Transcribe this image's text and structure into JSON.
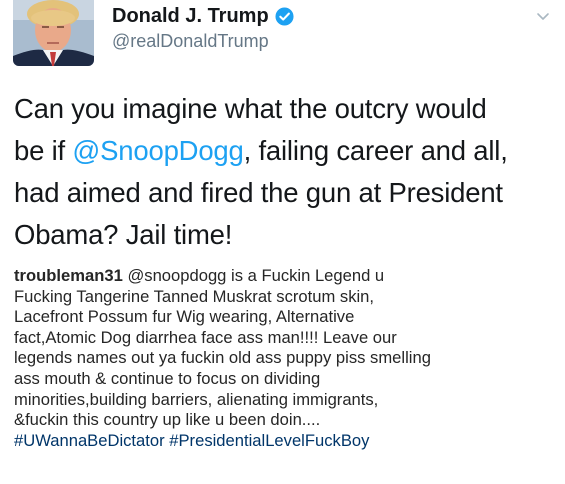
{
  "tweet": {
    "display_name": "Donald J. Trump",
    "handle": "@realDonaldTrump",
    "text_before": "Can you imagine what the outcry would\nbe if ",
    "mention": "@SnoopDogg",
    "text_after": ", failing career and all,\nhad aimed and fired the gun at President\nObama? Jail time!"
  },
  "comment": {
    "username": "troubleman31",
    "mention": "@snoopdogg",
    "text": " is a Fuckin Legend u\nFucking  Tangerine Tanned Muskrat scrotum skin,\nLacefront Possum fur Wig wearing, Alternative\nfact,Atomic Dog diarrhea face ass man!!!! Leave our\nlegends names out ya fuckin old ass puppy piss smelling\nass mouth & continue to focus on dividing\nminorities,building barriers, alienating immigrants,\n&fuckin this country up like u been doin....\n",
    "hashtag_1": "#UWannaBeDictator",
    "hashtag_2": "#PresidentialLevelFuckBoy"
  },
  "icons": {
    "verified": "verified-badge-icon",
    "menu": "chevron-down-icon"
  },
  "colors": {
    "link_blue": "#1da1f2",
    "verified_blue": "#1da1f2",
    "handle_gray": "#657786",
    "hashtag_navy": "#003569"
  }
}
